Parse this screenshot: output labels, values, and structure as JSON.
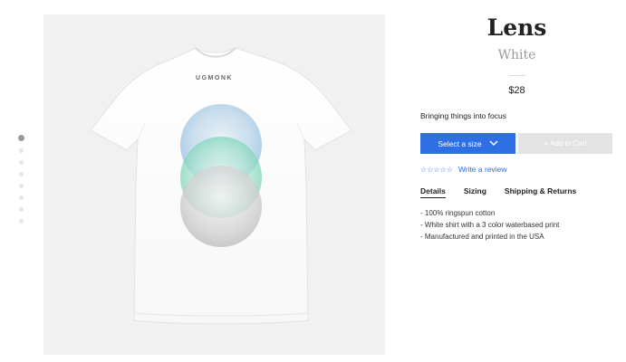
{
  "carousel": {
    "count": 8,
    "active_index": 0
  },
  "image": {
    "brand": "UGMONK"
  },
  "product": {
    "title": "Lens",
    "color": "White",
    "price": "$28",
    "tagline": "Bringing things into focus"
  },
  "actions": {
    "size_label": "Select a size",
    "cart_label": "+ Add to Cart"
  },
  "review": {
    "stars": "☆☆☆☆☆",
    "link_label": "Write a review"
  },
  "tabs": [
    {
      "label": "Details"
    },
    {
      "label": "Sizing"
    },
    {
      "label": "Shipping & Returns"
    }
  ],
  "details": [
    "100% ringspun cotton",
    "White shirt with a 3 color waterbased print",
    "Manufactured and printed in the USA"
  ],
  "colors": {
    "accent": "#2f6fe4",
    "disabled": "#e3e3e3"
  }
}
